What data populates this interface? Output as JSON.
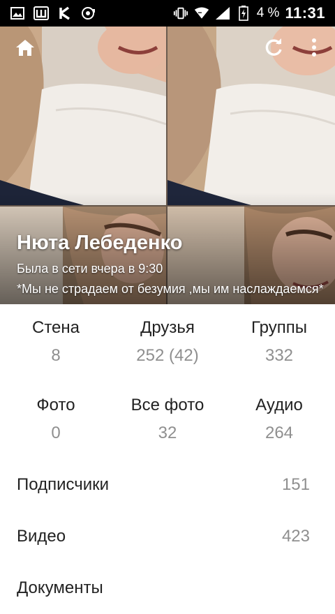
{
  "status_bar": {
    "battery_percent": "4 %",
    "time": "11:31",
    "left_icons": [
      "gallery-icon",
      "w-app-icon",
      "k-app-icon",
      "sync-disc-icon"
    ],
    "right_icons": [
      "vibrate-icon",
      "wifi-icon",
      "signal-icon",
      "battery-charging-icon"
    ]
  },
  "profile": {
    "name": "Нюта Лебеденко",
    "last_seen": "Была в сети вчера в 9:30",
    "status_text": "*Мы не страдаем от безумия ,мы им наслаждаемся*"
  },
  "toolbar": {
    "home_icon": "home-icon",
    "refresh_icon": "refresh-icon",
    "menu_icon": "more-vert-icon"
  },
  "stats": [
    [
      {
        "label": "Стена",
        "value": "8"
      },
      {
        "label": "Друзья",
        "value": "252 (42)"
      },
      {
        "label": "Группы",
        "value": "332"
      }
    ],
    [
      {
        "label": "Фото",
        "value": "0"
      },
      {
        "label": "Все фото",
        "value": "32"
      },
      {
        "label": "Аудио",
        "value": "264"
      }
    ]
  ],
  "list": [
    {
      "label": "Подписчики",
      "value": "151"
    },
    {
      "label": "Видео",
      "value": "423"
    },
    {
      "label": "Документы",
      "value": ""
    }
  ]
}
